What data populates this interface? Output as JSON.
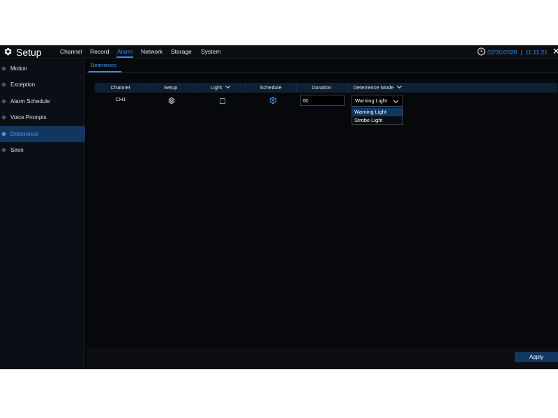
{
  "header": {
    "title": "Setup",
    "menu": [
      "Channel",
      "Record",
      "Alarm",
      "Network",
      "Storage",
      "System"
    ],
    "active_menu": "Alarm",
    "date": "02/20/2026",
    "time": "11:11:21",
    "accent_color": "#2d8cf0"
  },
  "sidebar": {
    "items": [
      {
        "label": "Motion"
      },
      {
        "label": "Exception"
      },
      {
        "label": "Alarm Schedule"
      },
      {
        "label": "Voice Prompts"
      },
      {
        "label": "Deterrence"
      },
      {
        "label": "Siren"
      }
    ],
    "active": "Deterrence"
  },
  "main": {
    "subtab": "Deterrence",
    "table": {
      "headers": [
        "Channel",
        "Setup",
        "Light",
        "Schedule",
        "Duration",
        "Deterrence Mode"
      ],
      "rows": [
        {
          "channel": "CH1",
          "light_checked": false,
          "duration": "60",
          "mode": "Warning Light"
        }
      ]
    },
    "mode_options": [
      "Warning Light",
      "Strobe Light"
    ],
    "apply_label": "Apply"
  },
  "icons": {
    "logo": "gear-icon",
    "clock": "clock-icon",
    "close": "close-icon",
    "setup": "gear-icon",
    "schedule": "gear-icon"
  }
}
